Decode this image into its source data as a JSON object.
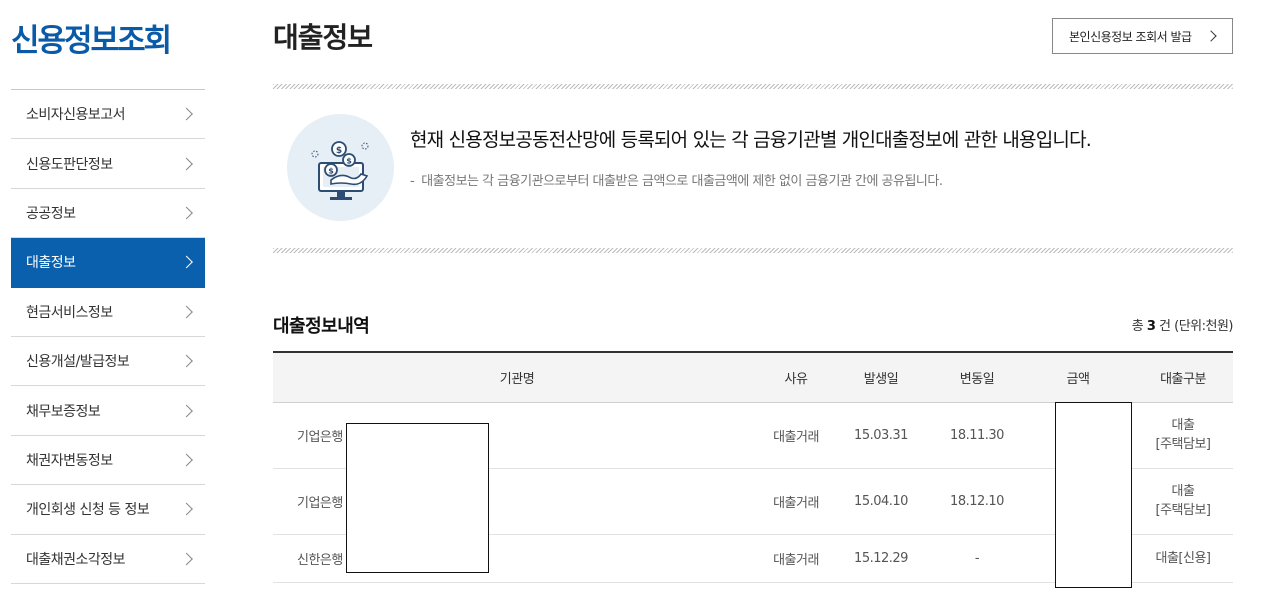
{
  "sidebar": {
    "title": "신용정보조회",
    "items": [
      {
        "label": "소비자신용보고서",
        "active": false
      },
      {
        "label": "신용도판단정보",
        "active": false
      },
      {
        "label": "공공정보",
        "active": false
      },
      {
        "label": "대출정보",
        "active": true
      },
      {
        "label": "현금서비스정보",
        "active": false
      },
      {
        "label": "신용개설/발급정보",
        "active": false
      },
      {
        "label": "채무보증정보",
        "active": false
      },
      {
        "label": "채권자변동정보",
        "active": false
      },
      {
        "label": "개인회생 신청 등 정보",
        "active": false
      },
      {
        "label": "대출채권소각정보",
        "active": false
      }
    ]
  },
  "header": {
    "title": "대출정보",
    "report_button": "본인신용정보 조회서 발급"
  },
  "info": {
    "icon": "money-monitor-icon",
    "headline": "현재 신용정보공동전산망에 등록되어 있는 각 금융기관별 개인대출정보에 관한 내용입니다.",
    "note": "대출정보는 각 금융기관으로부터 대출받은 금액으로 대출금액에 제한 없이 금융기관 간에 공유됩니다."
  },
  "section": {
    "title": "대출정보내역",
    "summary_prefix": "총",
    "summary_count": "3",
    "summary_suffix": "건 (단위:천원)"
  },
  "table": {
    "headers": [
      "기관명",
      "사유",
      "발생일",
      "변동일",
      "금액",
      "대출구분"
    ],
    "rows": [
      {
        "institution": "기업은행",
        "reason": "대출거래",
        "start": "15.03.31",
        "changed": "18.11.30",
        "amount": "",
        "category_line1": "대출",
        "category_line2": "[주택담보]"
      },
      {
        "institution": "기업은행",
        "reason": "대출거래",
        "start": "15.04.10",
        "changed": "18.12.10",
        "amount": "",
        "category_line1": "대출",
        "category_line2": "[주택담보]"
      },
      {
        "institution": "신한은행",
        "reason": "대출거래",
        "start": "15.12.29",
        "changed": "-",
        "amount": "",
        "category_line1": "대출[신용]",
        "category_line2": ""
      }
    ]
  },
  "colors": {
    "brand_blue": "#0b60ad",
    "title_blue": "#0a5aa8"
  }
}
